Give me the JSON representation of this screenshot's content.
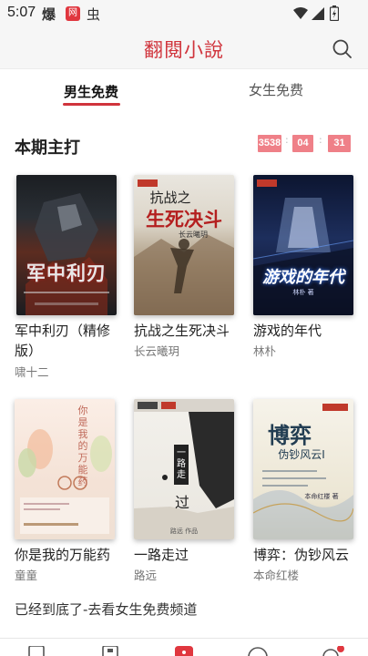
{
  "status": {
    "time": "5:07",
    "app_icon_1": "爆",
    "app_icon_2": "网",
    "app_icon_3": "虫"
  },
  "header": {
    "title": "翻閱小說"
  },
  "tabs": [
    {
      "label": "男生免费"
    },
    {
      "label": "女生免费"
    }
  ],
  "section": {
    "title": "本期主打",
    "countdown": {
      "hours": "3538",
      "minutes": "04",
      "seconds": "31"
    }
  },
  "books": [
    {
      "title": "军中利刃（精修版）",
      "title_line1": "军中利刃（精修",
      "title_line2": "版）",
      "author": "啸十二",
      "cover_title": "军中利刃"
    },
    {
      "title": "抗战之生死决斗",
      "author": "长云曦玥",
      "cover_title": "抗战之生死决斗",
      "cover_top": "抗战之",
      "cover_big": "生死决斗",
      "cover_author": "长云曦玥"
    },
    {
      "title": "游戏的年代",
      "author": "林朴",
      "cover_title": "游戏的年代",
      "cover_author": "林朴 著"
    },
    {
      "title": "你是我的万能药",
      "author": "童童",
      "cover_title": "你是我的万能药",
      "cover_vertical": "你是我的万能药"
    },
    {
      "title": "一路走过",
      "author": "路远",
      "cover_title": "一路走过",
      "cover_small": "一路走",
      "cover_big": "过",
      "cover_author": "路远 作品"
    },
    {
      "title": "博弈：伪钞风云",
      "author": "本命红楼",
      "cover_title": "博弈",
      "cover_sub": "伪钞风云Ⅰ",
      "cover_author": "本命红楼 著"
    }
  ],
  "footer": {
    "end_note": "已经到底了-去看女生免费频道"
  },
  "colors": {
    "accent": "#d0343c",
    "countdown_bg": "#ef8088"
  },
  "icons": [
    "wifi-icon",
    "signal-icon",
    "battery-icon",
    "search-icon",
    "bookshelf-icon",
    "library-icon",
    "home-icon",
    "discover-icon",
    "profile-icon"
  ]
}
